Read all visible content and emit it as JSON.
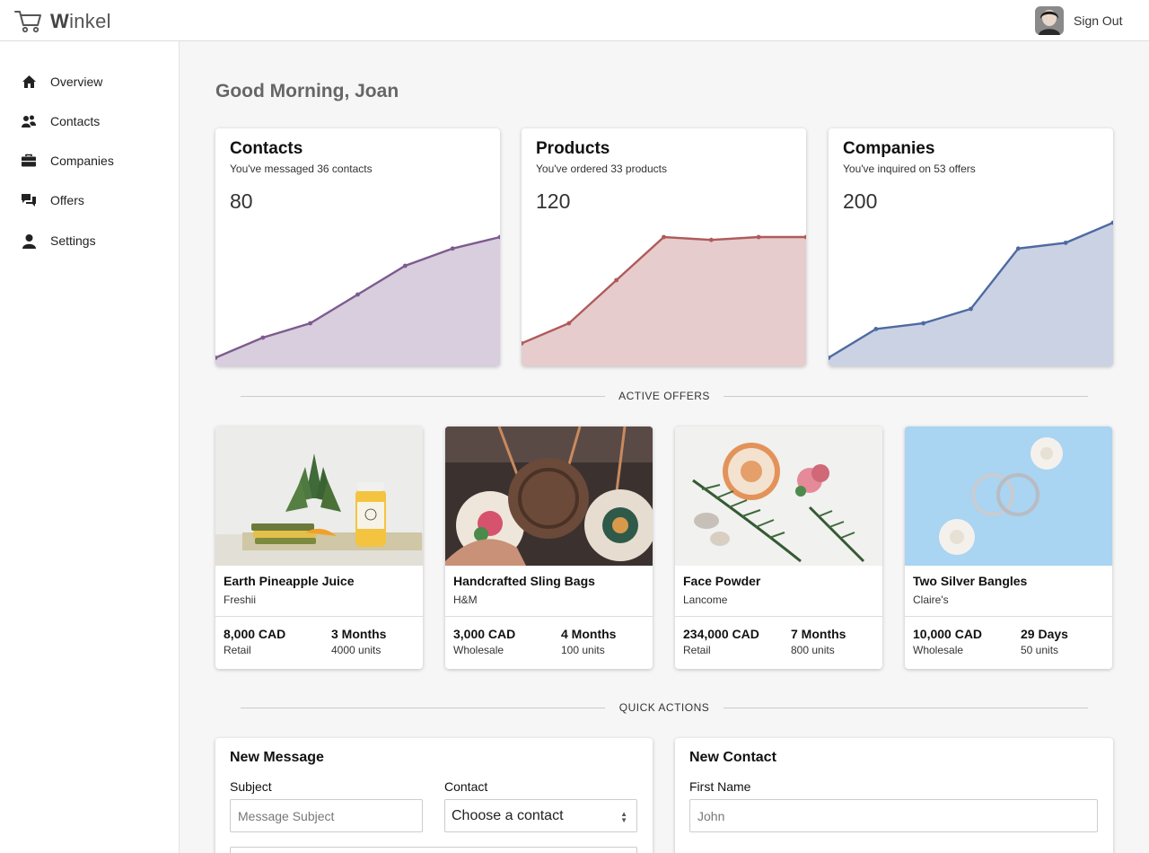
{
  "header": {
    "brand_first": "W",
    "brand_rest": "inkel",
    "signout_label": "Sign Out"
  },
  "sidebar": {
    "items": [
      {
        "label": "Overview",
        "icon": "home-icon"
      },
      {
        "label": "Contacts",
        "icon": "people-icon"
      },
      {
        "label": "Companies",
        "icon": "briefcase-icon"
      },
      {
        "label": "Offers",
        "icon": "chat-icon"
      },
      {
        "label": "Settings",
        "icon": "user-icon"
      }
    ]
  },
  "main": {
    "greeting": "Good Morning, Joan",
    "stats": [
      {
        "title": "Contacts",
        "subtitle": "You've messaged 36 contacts",
        "value": "80",
        "color": "#7d5b8f",
        "fill": "#d8cedd",
        "points": [
          3,
          10,
          15,
          25,
          35,
          41,
          45
        ]
      },
      {
        "title": "Products",
        "subtitle": "You've ordered 33 products",
        "value": "120",
        "color": "#b05a5a",
        "fill": "#e6cccc",
        "points": [
          8,
          15,
          30,
          45,
          44,
          45,
          45
        ]
      },
      {
        "title": "Companies",
        "subtitle": "You've inquired on 53 offers",
        "value": "200",
        "color": "#4e6aa1",
        "fill": "#cad2e4",
        "points": [
          3,
          13,
          15,
          20,
          41,
          43,
          50
        ]
      }
    ],
    "active_offers_heading": "ACTIVE OFFERS",
    "offers": [
      {
        "title": "Earth Pineapple Juice",
        "brand": "Freshii",
        "price": "8,000 CAD",
        "type": "Retail",
        "duration": "3 Months",
        "units": "4000 units"
      },
      {
        "title": "Handcrafted Sling Bags",
        "brand": "H&M",
        "price": "3,000 CAD",
        "type": "Wholesale",
        "duration": "4 Months",
        "units": "100 units"
      },
      {
        "title": "Face Powder",
        "brand": "Lancome",
        "price": "234,000 CAD",
        "type": "Retail",
        "duration": "7 Months",
        "units": "800 units"
      },
      {
        "title": "Two Silver Bangles",
        "brand": "Claire's",
        "price": "10,000 CAD",
        "type": "Wholesale",
        "duration": "29 Days",
        "units": "50 units"
      }
    ],
    "quick_actions_heading": "QUICK ACTIONS",
    "new_message": {
      "title": "New Message",
      "subject_label": "Subject",
      "subject_placeholder": "Message Subject",
      "contact_label": "Contact",
      "contact_selected": "Choose a contact"
    },
    "new_contact": {
      "title": "New Contact",
      "first_name_label": "First Name",
      "first_name_placeholder": "John"
    }
  }
}
